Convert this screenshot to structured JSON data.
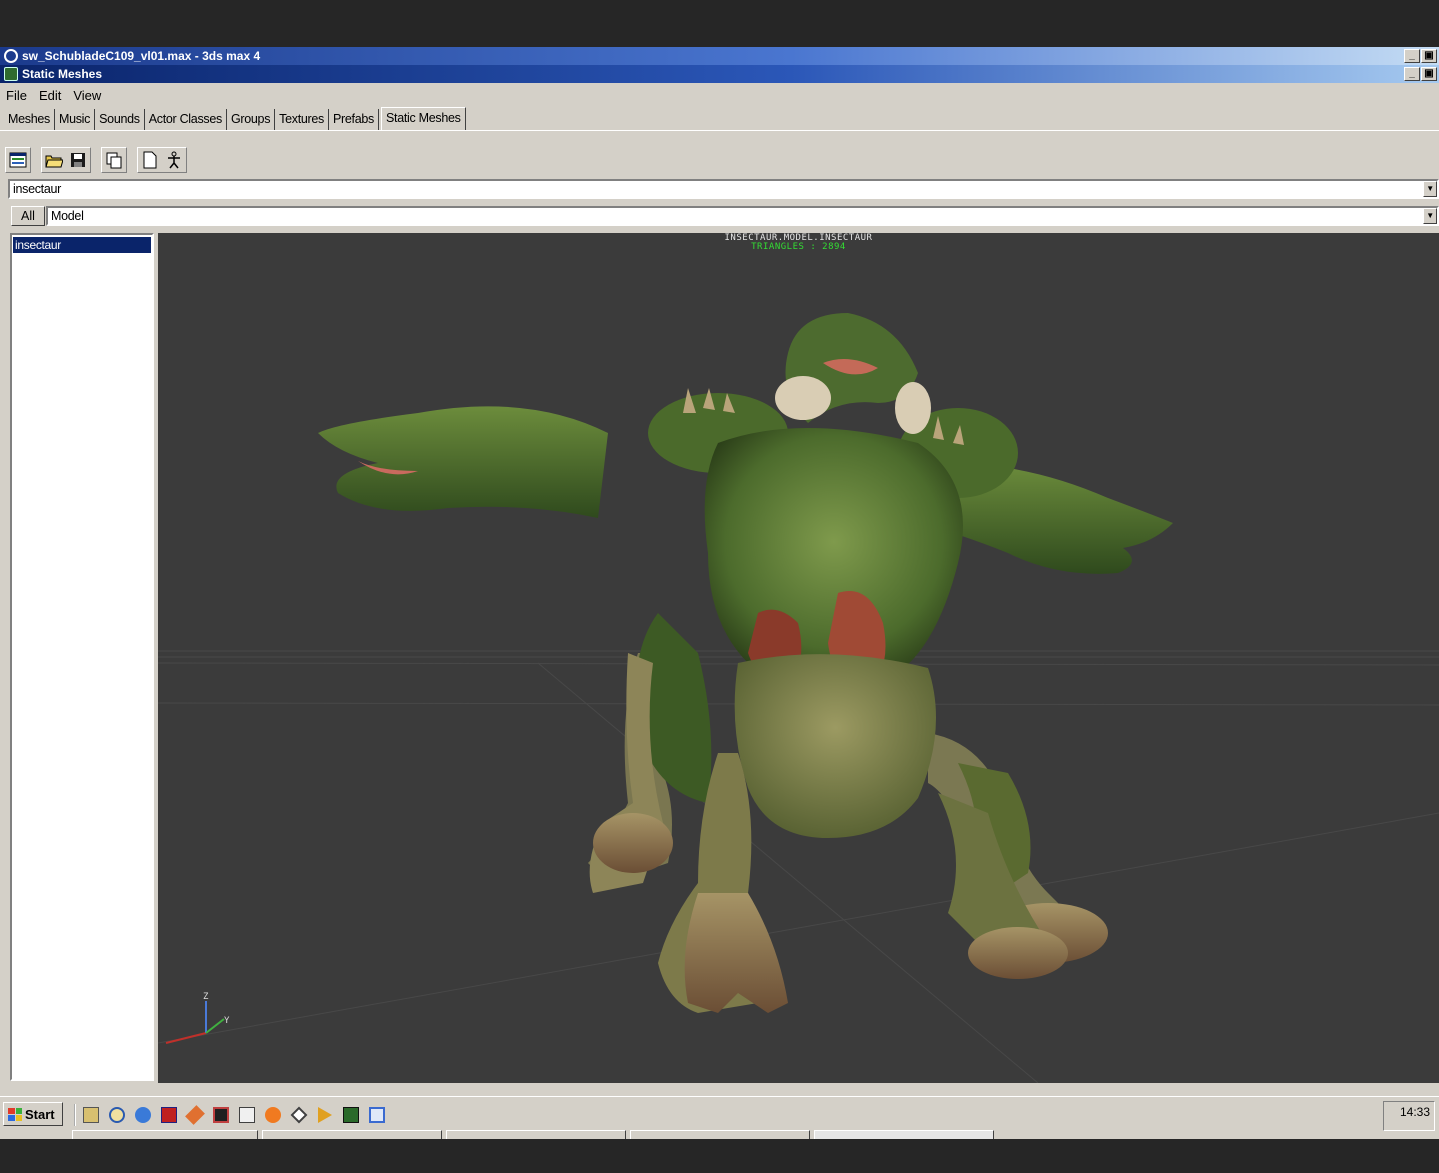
{
  "window": {
    "outer_title": "sw_SchubladeC109_vl01.max - 3ds max 4",
    "inner_title": "Static Meshes",
    "minimize_glyph": "_",
    "restore_glyph": "▣"
  },
  "menu": [
    "File",
    "Edit",
    "View"
  ],
  "tabs": [
    "Meshes",
    "Music",
    "Sounds",
    "Actor Classes",
    "Groups",
    "Textures",
    "Prefabs",
    "Static Meshes"
  ],
  "active_tab": "Static Meshes",
  "toolbar": {
    "icons": [
      "browser-icon",
      "open-folder-icon",
      "save-icon",
      "copy-icon",
      "new-document-icon",
      "actor-icon"
    ]
  },
  "package_combo": {
    "value": "insectaur"
  },
  "all_button": "All",
  "group_combo": {
    "value": "Model"
  },
  "mesh_list": [
    {
      "label": "insectaur",
      "selected": true
    }
  ],
  "viewport": {
    "mesh_label": "INSECTAUR.MODEL.INSECTAUR",
    "triangles_label": "TRIANGLES : 2894",
    "background_color": "#3b3b3b",
    "axis_labels": {
      "z": "Z",
      "y": "Y"
    }
  },
  "taskbar": {
    "start_label": "Start",
    "clock": "14:33",
    "quick_launch_icons": [
      "show-desktop-icon",
      "search-icon",
      "internet-explorer-icon",
      "app-red-icon",
      "app-tools-icon",
      "app-dark-icon",
      "app-window-icon",
      "app-orange-icon",
      "3dsmax-icon",
      "media-player-icon",
      "unreal-editor-icon",
      "app-blue-icon"
    ]
  },
  "colors": {
    "titlebar_active": "#0a246a",
    "selection": "#0a246a",
    "face_background": "#d4d0c8",
    "mesh_green": "#5a7a35",
    "stats_green": "#33dd33"
  }
}
